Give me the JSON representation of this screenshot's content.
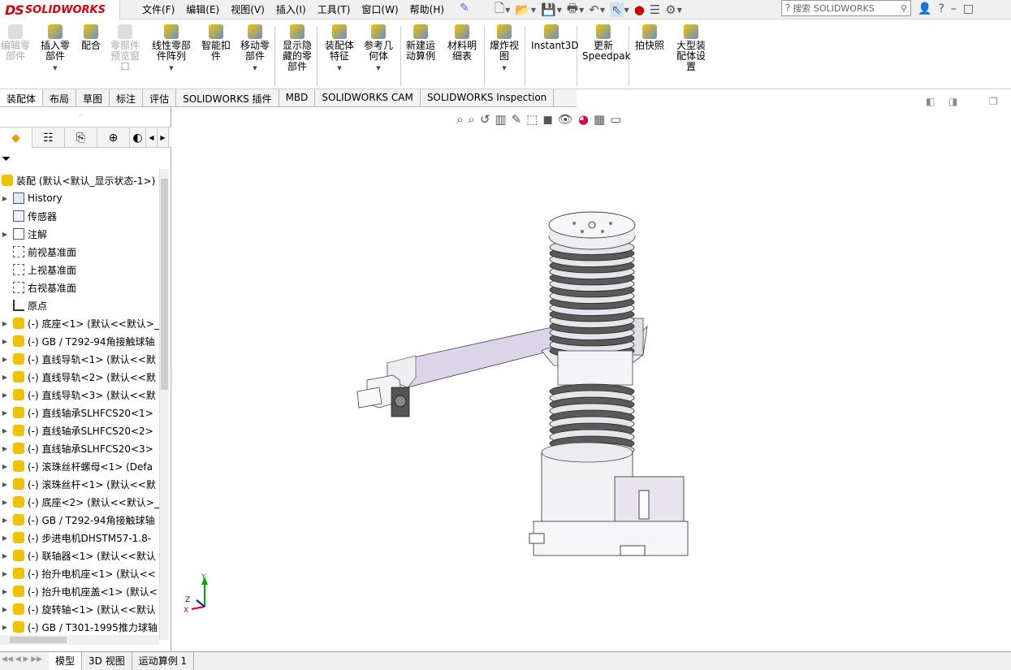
{
  "app": {
    "logo_ds": "DS",
    "logo_text": "SOLIDWORKS"
  },
  "menu": [
    "文件(F)",
    "编辑(E)",
    "视图(V)",
    "插入(I)",
    "工具(T)",
    "窗口(W)",
    "帮助(H)"
  ],
  "search": {
    "placeholder": "搜索 SOLIDWORKS"
  },
  "commands": [
    {
      "label": "编辑零\n部件",
      "disabled": true
    },
    {
      "label": "插入零\n部件",
      "disabled": false
    },
    {
      "label": "配合",
      "disabled": false
    },
    {
      "label": "零部件\n预览窗\n口",
      "disabled": true
    },
    {
      "label": "线性零部\n件阵列",
      "disabled": false
    },
    {
      "label": "智能扣\n件",
      "disabled": false
    },
    {
      "label": "移动零\n部件",
      "disabled": false
    },
    {
      "label": "显示隐\n藏的零\n部件",
      "disabled": false
    },
    {
      "label": "装配体\n特征",
      "disabled": false
    },
    {
      "label": "参考几\n何体",
      "disabled": false
    },
    {
      "label": "新建运\n动算例",
      "disabled": false
    },
    {
      "label": "材料明\n细表",
      "disabled": false
    },
    {
      "label": "爆炸视\n图",
      "disabled": false
    },
    {
      "label": "Instant3D",
      "disabled": false
    },
    {
      "label": "更新\nSpeedpak",
      "disabled": false
    },
    {
      "label": "拍快照",
      "disabled": false
    },
    {
      "label": "大型装\n配体设\n置",
      "disabled": false
    }
  ],
  "tabs": [
    "装配体",
    "布局",
    "草图",
    "标注",
    "评估",
    "SOLIDWORKS 插件",
    "MBD",
    "SOLIDWORKS CAM",
    "SOLIDWORKS Inspection"
  ],
  "tree": {
    "root": "装配 (默认<默认_显示状态-1>)",
    "items": [
      {
        "label": "History",
        "kind": "history",
        "expandable": true
      },
      {
        "label": "传感器",
        "kind": "sensor",
        "expandable": false
      },
      {
        "label": "注解",
        "kind": "annotation",
        "expandable": true
      },
      {
        "label": "前视基准面",
        "kind": "plane",
        "expandable": false
      },
      {
        "label": "上视基准面",
        "kind": "plane",
        "expandable": false
      },
      {
        "label": "右视基准面",
        "kind": "plane",
        "expandable": false
      },
      {
        "label": "原点",
        "kind": "origin",
        "expandable": false
      },
      {
        "label": "(-) 底座<1> (默认<<默认>_",
        "kind": "part",
        "expandable": true
      },
      {
        "label": "(-) GB / T292-94角接触球轴",
        "kind": "part",
        "expandable": true
      },
      {
        "label": "(-) 直线导轨<1> (默认<<默",
        "kind": "part",
        "expandable": true
      },
      {
        "label": "(-) 直线导轨<2> (默认<<默",
        "kind": "part",
        "expandable": true
      },
      {
        "label": "(-) 直线导轨<3> (默认<<默",
        "kind": "part",
        "expandable": true
      },
      {
        "label": "(-) 直线轴承SLHFCS20<1>",
        "kind": "part",
        "expandable": true
      },
      {
        "label": "(-) 直线轴承SLHFCS20<2>",
        "kind": "part",
        "expandable": true
      },
      {
        "label": "(-) 直线轴承SLHFCS20<3>",
        "kind": "part",
        "expandable": true
      },
      {
        "label": "(-) 滚珠丝杆螺母<1> (Defa",
        "kind": "part",
        "expandable": true
      },
      {
        "label": "(-) 滚珠丝杆<1> (默认<<默",
        "kind": "part",
        "expandable": true
      },
      {
        "label": "(-) 底座<2> (默认<<默认>_",
        "kind": "part",
        "expandable": true
      },
      {
        "label": "(-) GB / T292-94角接触球轴",
        "kind": "part",
        "expandable": true
      },
      {
        "label": "(-) 步进电机DHSTM57-1.8-",
        "kind": "part",
        "expandable": true
      },
      {
        "label": "(-) 联轴器<1> (默认<<默认",
        "kind": "part",
        "expandable": true
      },
      {
        "label": "(-) 抬升电机座<1> (默认<<",
        "kind": "part",
        "expandable": true
      },
      {
        "label": "(-) 抬升电机座盖<1> (默认<",
        "kind": "part",
        "expandable": true
      },
      {
        "label": "(-) 旋转轴<1> (默认<<默认",
        "kind": "part",
        "expandable": true
      },
      {
        "label": "(-) GB / T301-1995推力球轴",
        "kind": "part",
        "expandable": true
      }
    ]
  },
  "bottom_tabs": [
    "模型",
    "3D 视图",
    "运动算例 1"
  ],
  "triad": {
    "x": "X",
    "y": "Y",
    "z": "Z"
  },
  "colors": {
    "logo_red": "#d6000c",
    "part_yellow": "#f2c200",
    "model_grey": "#e8e8ee",
    "model_purple": "#d8d0e4",
    "bellows_dark": "#555555"
  }
}
